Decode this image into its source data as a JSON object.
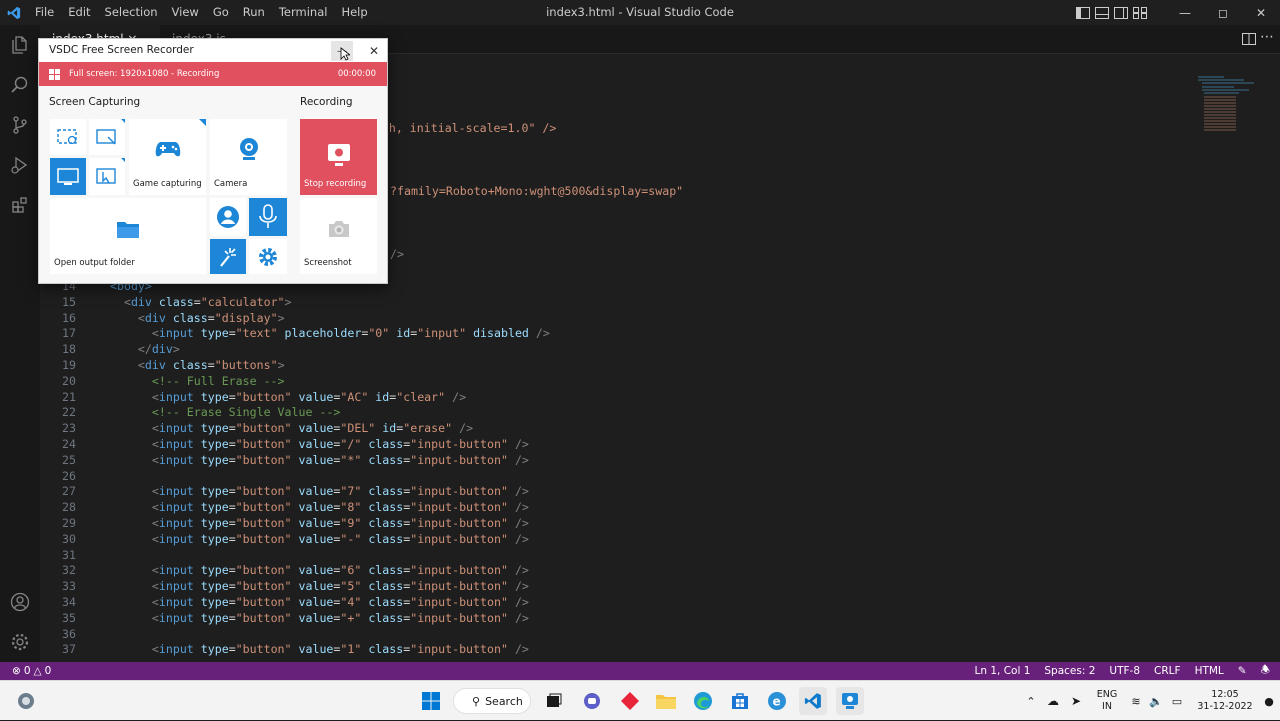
{
  "window": {
    "title": "index3.html - Visual Studio Code",
    "menus": [
      "File",
      "Edit",
      "Selection",
      "View",
      "Go",
      "Run",
      "Terminal",
      "Help"
    ]
  },
  "tabs": [
    {
      "label": "index3.html ×"
    },
    {
      "label": "index3.js"
    }
  ],
  "breadcrumb": "> ...",
  "code": {
    "top_partial": [
      {
        "text": "ce-width, initial-scale=1.0\" />"
      },
      {
        "text": "?family=Roboto+Mono:wght@500&display=swap\""
      },
      {
        "text": "/>"
      }
    ],
    "lines": [
      {
        "n": "14",
        "html": "<span class=\"tg\">&lt;body&gt;</span>"
      },
      {
        "n": "15",
        "html": "  <span class=\"pn\">&lt;</span><span class=\"tg\">div</span> <span class=\"at\">class</span>=<span class=\"st\">\"calculator\"</span><span class=\"pn\">&gt;</span>"
      },
      {
        "n": "16",
        "html": "    <span class=\"pn\">&lt;</span><span class=\"tg\">div</span> <span class=\"at\">class</span>=<span class=\"st\">\"display\"</span><span class=\"pn\">&gt;</span>"
      },
      {
        "n": "17",
        "html": "      <span class=\"pn\">&lt;</span><span class=\"tg\">input</span> <span class=\"at\">type</span>=<span class=\"st\">\"text\"</span> <span class=\"at\">placeholder</span>=<span class=\"st\">\"0\"</span> <span class=\"at\">id</span>=<span class=\"st\">\"input\"</span> <span class=\"at\">disabled</span> <span class=\"pn\">/&gt;</span>"
      },
      {
        "n": "18",
        "html": "    <span class=\"pn\">&lt;/</span><span class=\"tg\">div</span><span class=\"pn\">&gt;</span>"
      },
      {
        "n": "19",
        "html": "    <span class=\"pn\">&lt;</span><span class=\"tg\">div</span> <span class=\"at\">class</span>=<span class=\"st\">\"buttons\"</span><span class=\"pn\">&gt;</span>"
      },
      {
        "n": "20",
        "html": "      <span class=\"cm\">&lt;!-- Full Erase --&gt;</span>"
      },
      {
        "n": "21",
        "html": "      <span class=\"pn\">&lt;</span><span class=\"tg\">input</span> <span class=\"at\">type</span>=<span class=\"st\">\"button\"</span> <span class=\"at\">value</span>=<span class=\"st\">\"AC\"</span> <span class=\"at\">id</span>=<span class=\"st\">\"clear\"</span> <span class=\"pn\">/&gt;</span>"
      },
      {
        "n": "22",
        "html": "      <span class=\"cm\">&lt;!-- Erase Single Value --&gt;</span>"
      },
      {
        "n": "23",
        "html": "      <span class=\"pn\">&lt;</span><span class=\"tg\">input</span> <span class=\"at\">type</span>=<span class=\"st\">\"button\"</span> <span class=\"at\">value</span>=<span class=\"st\">\"DEL\"</span> <span class=\"at\">id</span>=<span class=\"st\">\"erase\"</span> <span class=\"pn\">/&gt;</span>"
      },
      {
        "n": "24",
        "html": "      <span class=\"pn\">&lt;</span><span class=\"tg\">input</span> <span class=\"at\">type</span>=<span class=\"st\">\"button\"</span> <span class=\"at\">value</span>=<span class=\"st\">\"/\"</span> <span class=\"at\">class</span>=<span class=\"st\">\"input-button\"</span> <span class=\"pn\">/&gt;</span>"
      },
      {
        "n": "25",
        "html": "      <span class=\"pn\">&lt;</span><span class=\"tg\">input</span> <span class=\"at\">type</span>=<span class=\"st\">\"button\"</span> <span class=\"at\">value</span>=<span class=\"st\">\"*\"</span> <span class=\"at\">class</span>=<span class=\"st\">\"input-button\"</span> <span class=\"pn\">/&gt;</span>"
      },
      {
        "n": "26",
        "html": ""
      },
      {
        "n": "27",
        "html": "      <span class=\"pn\">&lt;</span><span class=\"tg\">input</span> <span class=\"at\">type</span>=<span class=\"st\">\"button\"</span> <span class=\"at\">value</span>=<span class=\"st\">\"7\"</span> <span class=\"at\">class</span>=<span class=\"st\">\"input-button\"</span> <span class=\"pn\">/&gt;</span>"
      },
      {
        "n": "28",
        "html": "      <span class=\"pn\">&lt;</span><span class=\"tg\">input</span> <span class=\"at\">type</span>=<span class=\"st\">\"button\"</span> <span class=\"at\">value</span>=<span class=\"st\">\"8\"</span> <span class=\"at\">class</span>=<span class=\"st\">\"input-button\"</span> <span class=\"pn\">/&gt;</span>"
      },
      {
        "n": "29",
        "html": "      <span class=\"pn\">&lt;</span><span class=\"tg\">input</span> <span class=\"at\">type</span>=<span class=\"st\">\"button\"</span> <span class=\"at\">value</span>=<span class=\"st\">\"9\"</span> <span class=\"at\">class</span>=<span class=\"st\">\"input-button\"</span> <span class=\"pn\">/&gt;</span>"
      },
      {
        "n": "30",
        "html": "      <span class=\"pn\">&lt;</span><span class=\"tg\">input</span> <span class=\"at\">type</span>=<span class=\"st\">\"button\"</span> <span class=\"at\">value</span>=<span class=\"st\">\"-\"</span> <span class=\"at\">class</span>=<span class=\"st\">\"input-button\"</span> <span class=\"pn\">/&gt;</span>"
      },
      {
        "n": "31",
        "html": ""
      },
      {
        "n": "32",
        "html": "      <span class=\"pn\">&lt;</span><span class=\"tg\">input</span> <span class=\"at\">type</span>=<span class=\"st\">\"button\"</span> <span class=\"at\">value</span>=<span class=\"st\">\"6\"</span> <span class=\"at\">class</span>=<span class=\"st\">\"input-button\"</span> <span class=\"pn\">/&gt;</span>"
      },
      {
        "n": "33",
        "html": "      <span class=\"pn\">&lt;</span><span class=\"tg\">input</span> <span class=\"at\">type</span>=<span class=\"st\">\"button\"</span> <span class=\"at\">value</span>=<span class=\"st\">\"5\"</span> <span class=\"at\">class</span>=<span class=\"st\">\"input-button\"</span> <span class=\"pn\">/&gt;</span>"
      },
      {
        "n": "34",
        "html": "      <span class=\"pn\">&lt;</span><span class=\"tg\">input</span> <span class=\"at\">type</span>=<span class=\"st\">\"button\"</span> <span class=\"at\">value</span>=<span class=\"st\">\"4\"</span> <span class=\"at\">class</span>=<span class=\"st\">\"input-button\"</span> <span class=\"pn\">/&gt;</span>"
      },
      {
        "n": "35",
        "html": "      <span class=\"pn\">&lt;</span><span class=\"tg\">input</span> <span class=\"at\">type</span>=<span class=\"st\">\"button\"</span> <span class=\"at\">value</span>=<span class=\"st\">\"+\"</span> <span class=\"at\">class</span>=<span class=\"st\">\"input-button\"</span> <span class=\"pn\">/&gt;</span>"
      },
      {
        "n": "36",
        "html": ""
      },
      {
        "n": "37",
        "html": "      <span class=\"pn\">&lt;</span><span class=\"tg\">input</span> <span class=\"at\">type</span>=<span class=\"st\">\"button\"</span> <span class=\"at\">value</span>=<span class=\"st\">\"1\"</span> <span class=\"at\">class</span>=<span class=\"st\">\"input-button\"</span> <span class=\"pn\">/&gt;</span>"
      }
    ]
  },
  "statusbar": {
    "errors": "0",
    "warnings": "0",
    "position": "Ln 1, Col 1",
    "spaces": "Spaces: 2",
    "encoding": "UTF-8",
    "eol": "CRLF",
    "language": "HTML"
  },
  "vsdc": {
    "title": "VSDC Free Screen Recorder",
    "status": "Full screen: 1920x1080 - Recording",
    "time": "00:00:00",
    "section_capture": "Screen Capturing",
    "section_recording": "Recording",
    "game_capturing": "Game capturing",
    "camera": "Camera",
    "stop_recording": "Stop recording",
    "open_output_folder": "Open output folder",
    "screenshot": "Screenshot",
    "colors": {
      "accent_red": "#e0505e",
      "accent_blue": "#1e86d6"
    }
  },
  "taskbar": {
    "search_label": "Search",
    "lang_line1": "ENG",
    "lang_line2": "IN",
    "time": "12:05",
    "date": "31-12-2022"
  },
  "colors": {
    "statusbar": "#68217a",
    "editor_bg": "#1e1e1e"
  }
}
